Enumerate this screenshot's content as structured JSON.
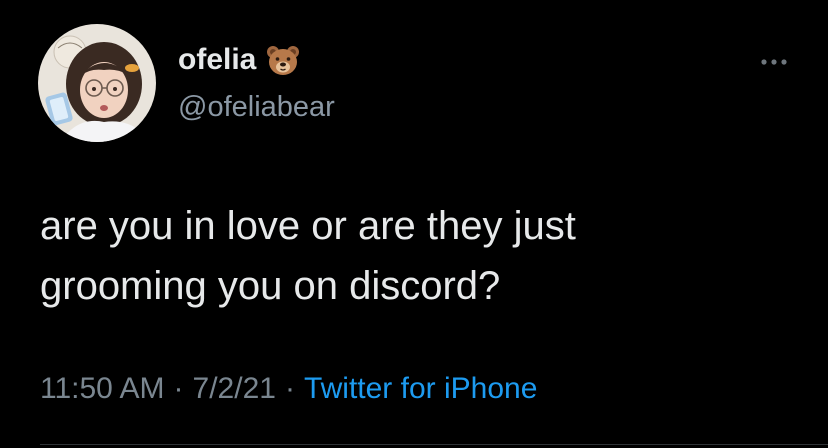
{
  "tweet": {
    "display_name": "ofelia",
    "name_emoji": "bear-face-emoji",
    "handle": "@ofeliabear",
    "text": "are you in love or are they just\ngrooming you on discord?",
    "time": "11:50 AM",
    "date": "7/2/21",
    "separator": "·",
    "source": "Twitter for iPhone"
  },
  "colors": {
    "background": "#000000",
    "text": "#e7e9ea",
    "secondary": "#8b98a5",
    "link": "#1d9bf0"
  },
  "icons": {
    "more": "more-dots-icon"
  }
}
